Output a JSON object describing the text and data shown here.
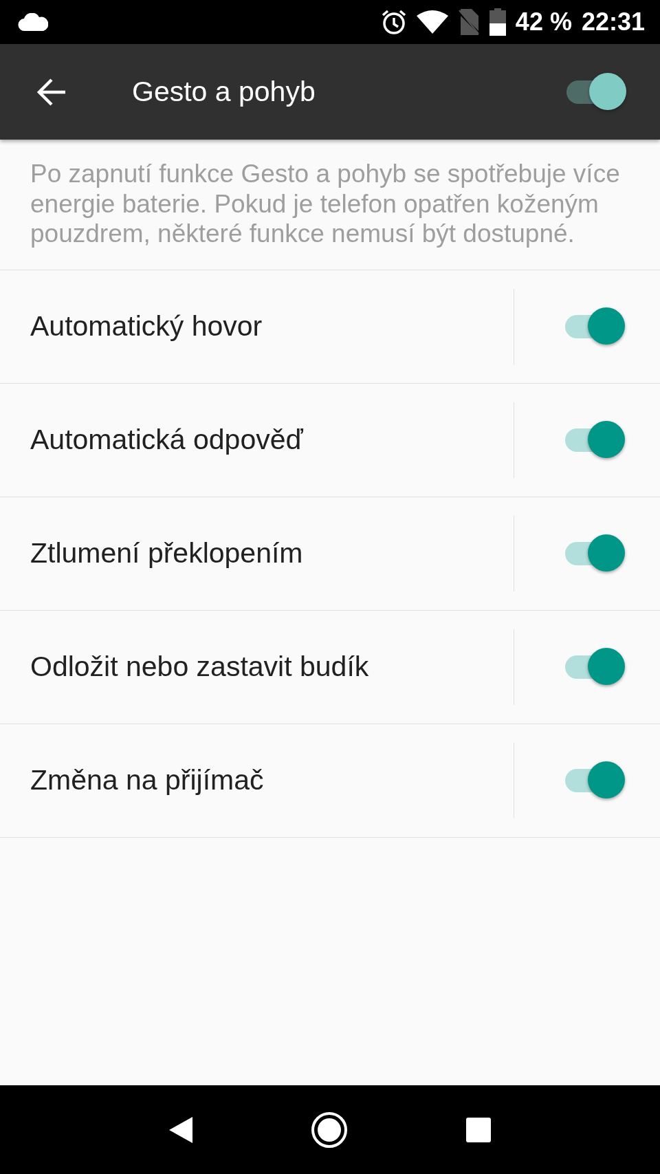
{
  "status_bar": {
    "battery": "42 %",
    "time": "22:31"
  },
  "app_bar": {
    "title": "Gesto a pohyb",
    "master_switch": {
      "on": true
    }
  },
  "description": "Po zapnutí funkce Gesto a pohyb se spotřebuje více energie baterie. Pokud je telefon opatřen koženým pouzdrem, některé funkce nemusí být dostupné.",
  "settings": [
    {
      "label": "Automatický hovor",
      "on": true
    },
    {
      "label": "Automatická odpověď",
      "on": true
    },
    {
      "label": "Ztlumení překlopením",
      "on": true
    },
    {
      "label": "Odložit nebo zastavit budík",
      "on": true
    },
    {
      "label": "Změna na přijímač",
      "on": true
    }
  ]
}
